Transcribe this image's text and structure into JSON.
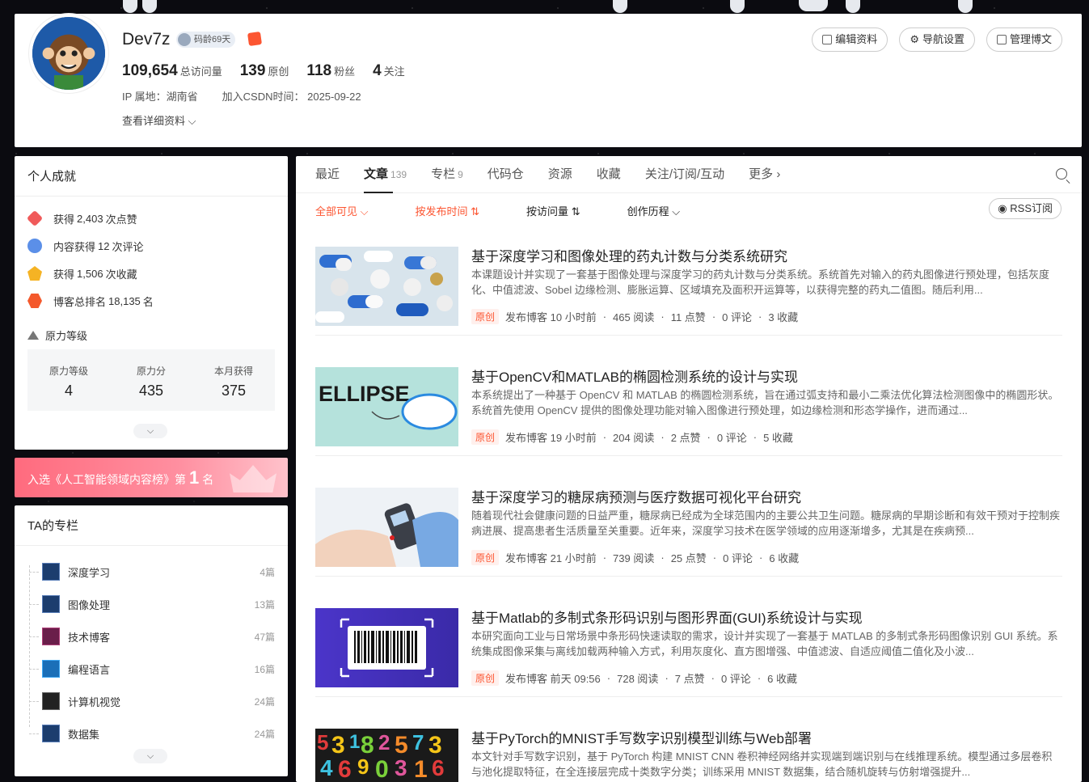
{
  "profile": {
    "name": "Dev7z",
    "code_age": "码龄69天",
    "stats": [
      {
        "value": "109,654",
        "label": "总访问量"
      },
      {
        "value": "139",
        "label": "原创"
      },
      {
        "value": "118",
        "label": "粉丝"
      },
      {
        "value": "4",
        "label": "关注"
      }
    ],
    "ip": "IP 属地：湖南省",
    "joined": "加入CSDN时间： 2025-09-22",
    "more_info": "查看详细资料",
    "buttons": [
      "编辑资料",
      "导航设置",
      "管理博文"
    ]
  },
  "achievements": {
    "title": "个人成就",
    "items": [
      {
        "icon": "like-icon",
        "pre": "获得",
        "value": "2,403",
        "post": "次点赞"
      },
      {
        "icon": "comment-icon",
        "pre": "内容获得",
        "value": "12",
        "post": "次评论"
      },
      {
        "icon": "favorite-icon",
        "pre": "获得",
        "value": "1,506",
        "post": "次收藏"
      },
      {
        "icon": "rank-icon",
        "pre": "博客总排名",
        "value": "18,135",
        "post": "名"
      }
    ],
    "level_title": "原力等级",
    "level": [
      {
        "label": "原力等级",
        "value": "4"
      },
      {
        "label": "原力分",
        "value": "435"
      },
      {
        "label": "本月获得",
        "value": "375"
      }
    ]
  },
  "banner": {
    "pre": "入选《人工智能领域内容榜》第",
    "rank": "1",
    "post": "名"
  },
  "columns": {
    "title": "TA的专栏",
    "items": [
      {
        "name": "深度学习",
        "count": "4篇"
      },
      {
        "name": "图像处理",
        "count": "13篇"
      },
      {
        "name": "技术博客",
        "count": "47篇"
      },
      {
        "name": "编程语言",
        "count": "16篇"
      },
      {
        "name": "计算机视觉",
        "count": "24篇"
      },
      {
        "name": "数据集",
        "count": "24篇"
      }
    ]
  },
  "tabs": [
    {
      "label": "最近",
      "count": ""
    },
    {
      "label": "文章",
      "count": "139"
    },
    {
      "label": "专栏",
      "count": "9"
    },
    {
      "label": "代码仓",
      "count": ""
    },
    {
      "label": "资源",
      "count": ""
    },
    {
      "label": "收藏",
      "count": ""
    },
    {
      "label": "关注/订阅/互动",
      "count": ""
    },
    {
      "label": "更多",
      "count": ""
    }
  ],
  "filters": {
    "visibility": "全部可见",
    "by_time": "按发布时间",
    "by_views": "按访问量",
    "history": "创作历程",
    "rss": "RSS订阅"
  },
  "articles": [
    {
      "title": "基于深度学习和图像处理的药丸计数与分类系统研究",
      "desc": "本课题设计并实现了一套基于图像处理与深度学习的药丸计数与分类系统。系统首先对输入的药丸图像进行预处理，包括灰度化、中值滤波、Sobel 边缘检测、膨胀运算、区域填充及面积开运算等，以获得完整的药丸二值图。随后利用...",
      "tag": "原创",
      "time": "发布博客 10 小时前",
      "reads": "465 阅读",
      "likes": "11 点赞",
      "comments": "0 评论",
      "favs": "3 收藏"
    },
    {
      "title": "基于OpenCV和MATLAB的椭圆检测系统的设计与实现",
      "desc": "本系统提出了一种基于 OpenCV 和 MATLAB 的椭圆检测系统，旨在通过弧支持和最小二乘法优化算法检测图像中的椭圆形状。系统首先使用 OpenCV 提供的图像处理功能对输入图像进行预处理，如边缘检测和形态学操作，进而通过...",
      "tag": "原创",
      "time": "发布博客 19 小时前",
      "reads": "204 阅读",
      "likes": "2 点赞",
      "comments": "0 评论",
      "favs": "5 收藏",
      "thumb_text": "ELLIPSE"
    },
    {
      "title": "基于深度学习的糖尿病预测与医疗数据可视化平台研究",
      "desc": "随着现代社会健康问题的日益严重，糖尿病已经成为全球范围内的主要公共卫生问题。糖尿病的早期诊断和有效干预对于控制疾病进展、提高患者生活质量至关重要。近年来，深度学习技术在医学领域的应用逐渐增多，尤其是在疾病预...",
      "tag": "原创",
      "time": "发布博客 21 小时前",
      "reads": "739 阅读",
      "likes": "25 点赞",
      "comments": "0 评论",
      "favs": "6 收藏"
    },
    {
      "title": "基于Matlab的多制式条形码识别与图形界面(GUI)系统设计与实现",
      "desc": "本研究面向工业与日常场景中条形码快速读取的需求，设计并实现了一套基于 MATLAB 的多制式条形码图像识别 GUI 系统。系统集成图像采集与离线加载两种输入方式，利用灰度化、直方图增强、中值滤波、自适应阈值二值化及小波...",
      "tag": "原创",
      "time": "发布博客 前天 09:56",
      "reads": "728 阅读",
      "likes": "7 点赞",
      "comments": "0 评论",
      "favs": "6 收藏"
    },
    {
      "title": "基于PyTorch的MNIST手写数字识别模型训练与Web部署",
      "desc": "本文针对手写数字识别，基于 PyTorch 构建 MNIST CNN 卷积神经网络并实现端到端识别与在线推理系统。模型通过多层卷积与池化提取特征，在全连接层完成十类数字分类；训练采用 MNIST 数据集，结合随机旋转与仿射增强提升...",
      "tag": "原创",
      "time": "",
      "reads": "",
      "likes": "",
      "comments": "",
      "favs": ""
    }
  ]
}
